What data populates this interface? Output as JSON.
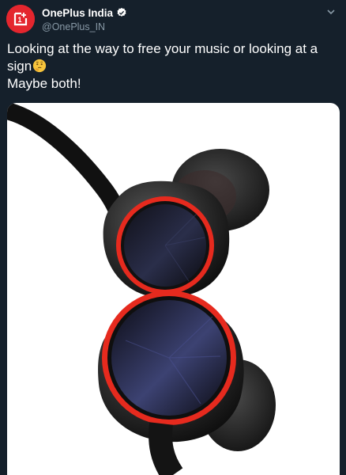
{
  "account": {
    "display_name": "OnePlus India",
    "handle": "@OnePlus_IN",
    "verified": true,
    "avatar_icon": "oneplus-logo-icon",
    "avatar_logo_text": "1+",
    "brand_color": "#e4262e"
  },
  "tweet": {
    "line1": "Looking at the way to free your music or looking at a",
    "line2_text": "sign",
    "line2_emoji": "thinking-face-emoji",
    "line3": "Maybe both!"
  },
  "media": {
    "type": "photo",
    "subject": "earphones-photo"
  },
  "colors": {
    "background": "#15202b",
    "secondary_text": "#8899a6",
    "verified_badge": "#ffffff",
    "accent_red": "#e4262e"
  }
}
